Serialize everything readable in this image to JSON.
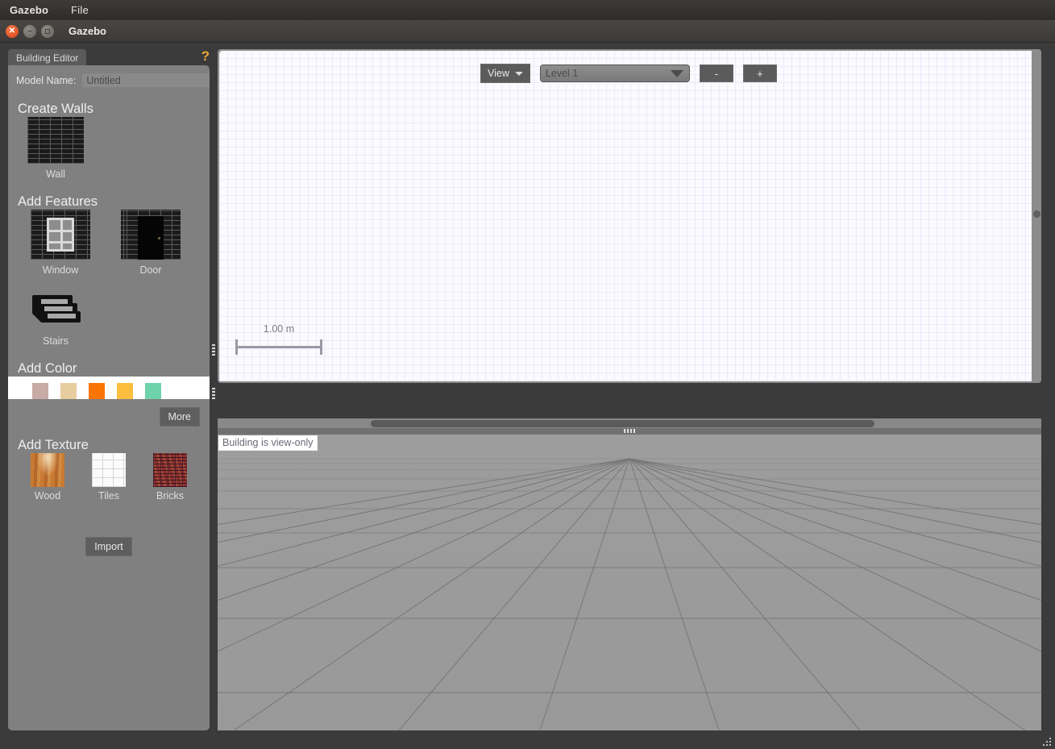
{
  "menubar": {
    "app": "Gazebo",
    "file": "File"
  },
  "window": {
    "title": "Gazebo",
    "close_icon": "close-icon",
    "minimize_icon": "minimize-icon",
    "maximize_icon": "maximize-icon"
  },
  "panel": {
    "tab_label": "Building Editor",
    "help_icon": "question-mark-icon",
    "model_name_label": "Model Name:",
    "model_name_value": "Untitled",
    "sections": {
      "create_walls": {
        "heading": "Create Walls",
        "items": [
          {
            "label": "Wall",
            "icon": "brick-wall-icon"
          }
        ]
      },
      "add_features": {
        "heading": "Add Features",
        "items": [
          {
            "label": "Window",
            "icon": "window-icon"
          },
          {
            "label": "Door",
            "icon": "door-icon"
          },
          {
            "label": "Stairs",
            "icon": "stairs-icon"
          }
        ]
      },
      "add_color": {
        "heading": "Add Color",
        "swatches": [
          "#ffffff",
          "#c9aba5",
          "#e8cda1",
          "#fb7505",
          "#fdbd3e",
          "#6ed3a8"
        ],
        "more_label": "More"
      },
      "add_texture": {
        "heading": "Add Texture",
        "items": [
          {
            "label": "Wood",
            "icon": "wood-texture-icon"
          },
          {
            "label": "Tiles",
            "icon": "tiles-texture-icon"
          },
          {
            "label": "Bricks",
            "icon": "bricks-texture-icon"
          }
        ],
        "import_label": "Import"
      }
    }
  },
  "editor_2d": {
    "toolbar": {
      "view_label": "View",
      "view_caret_icon": "chevron-down-icon",
      "level_value": "Level 1",
      "level_caret_icon": "chevron-down-icon",
      "zoom_out_label": "-",
      "zoom_in_label": "+"
    },
    "scale_bar": {
      "label": "1.00 m"
    }
  },
  "view_3d": {
    "status": "Building is view-only"
  },
  "colors": {
    "panel_bg": "#808080",
    "window_chrome": "#3b3b3b",
    "accent_help": "#f0a839",
    "grid_2d_bg": "#fafaff",
    "grid_2d_line": "#ebebfa",
    "viewport_3d_bg": "#9a9a9a"
  }
}
